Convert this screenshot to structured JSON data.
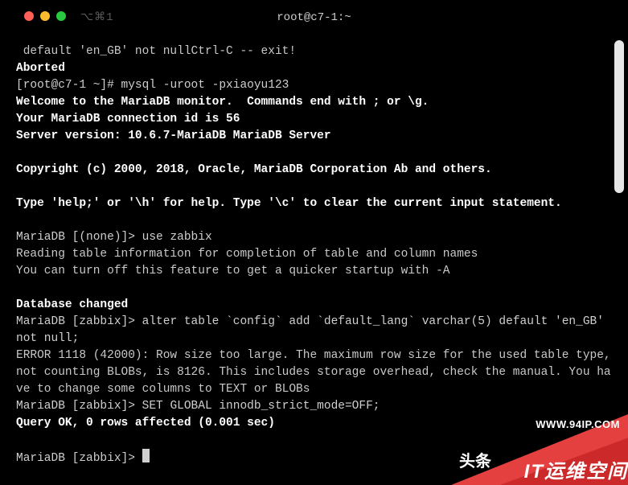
{
  "window": {
    "title": "root@c7-1:~",
    "shortcut": "⌥⌘1"
  },
  "lines": {
    "l00": " default 'en_GB' not nullCtrl-C -- exit!",
    "l01": "Aborted",
    "l02_prompt": "[root@c7-1 ~]# ",
    "l02_cmd": "mysql -uroot -pxiaoyu123",
    "l03": "Welcome to the MariaDB monitor.  Commands end with ; or \\g.",
    "l04": "Your MariaDB connection id is 56",
    "l05": "Server version: 10.6.7-MariaDB MariaDB Server",
    "l06": "Copyright (c) 2000, 2018, Oracle, MariaDB Corporation Ab and others.",
    "l07": "Type 'help;' or '\\h' for help. Type '\\c' to clear the current input statement.",
    "l08_prompt": "MariaDB [(none)]> ",
    "l08_cmd": "use zabbix",
    "l09": "Reading table information for completion of table and column names",
    "l10": "You can turn off this feature to get a quicker startup with -A",
    "l11": "Database changed",
    "l12_prompt": "MariaDB [zabbix]> ",
    "l12_cmd": "alter table `config` add `default_lang` varchar(5) default 'en_GB' not null;",
    "l13": "ERROR 1118 (42000): Row size too large. The maximum row size for the used table type, not counting BLOBs, is 8126. This includes storage overhead, check the manual. You have to change some columns to TEXT or BLOBs",
    "l14_prompt": "MariaDB [zabbix]> ",
    "l14_cmd": "SET GLOBAL innodb_strict_mode=OFF;",
    "l15": "Query OK, 0 rows affected (0.001 sec)",
    "l16_prompt": "MariaDB [zabbix]> "
  },
  "watermark": {
    "url": "WWW.94IP.COM",
    "brand": "IT运维空间",
    "partial": "头条"
  }
}
